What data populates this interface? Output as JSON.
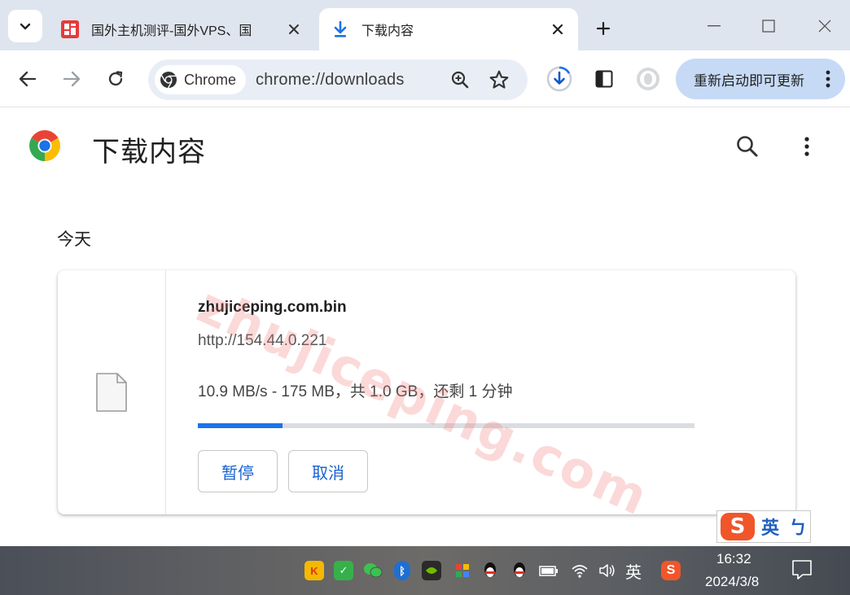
{
  "browser": {
    "tabs": [
      {
        "title": "国外主机测评-国外VPS、国",
        "active": false
      },
      {
        "title": "下载内容",
        "active": true
      }
    ],
    "omnibox": {
      "chip_label": "Chrome",
      "url": "chrome://downloads"
    },
    "update_button_label": "重新启动即可更新"
  },
  "page": {
    "title": "下载内容",
    "section_label": "今天",
    "downloads": [
      {
        "file_name": "zhujiceping.com.bin",
        "source_url": "http://154.44.0.221",
        "status": "10.9 MB/s - 175 MB，共 1.0 GB，还剩 1 分钟",
        "progress_fraction": 0.17,
        "pause_label": "暂停",
        "cancel_label": "取消"
      }
    ]
  },
  "watermark": "zhujiceping.com",
  "ime": {
    "logo": "S",
    "language": "英",
    "punct": "ㄅ"
  },
  "taskbar": {
    "ime_indicator": "英",
    "time": "16:32",
    "date": "2024/3/8"
  },
  "colors": {
    "accent": "#1a73e8",
    "tabstrip_bg": "#dfe5ee",
    "omnibox_bg": "#e9eef6",
    "update_bg": "#c6daf6",
    "watermark": "#f07878"
  }
}
